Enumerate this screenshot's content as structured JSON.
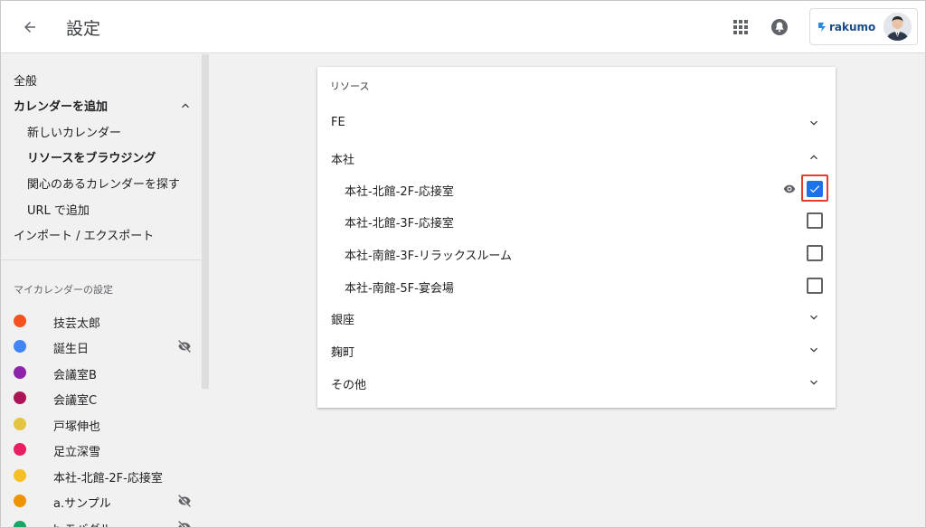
{
  "header": {
    "title": "設定",
    "brand": "rakumo",
    "icons": {
      "back": "arrow-back-icon",
      "apps": "apps-grid-icon",
      "notifications": "bell-icon"
    }
  },
  "sidebar": {
    "nav": [
      {
        "label": "全般"
      },
      {
        "label": "カレンダーを追加"
      },
      {
        "label": "新しいカレンダー"
      },
      {
        "label": "リソースをブラウジング"
      },
      {
        "label": "関心のあるカレンダーを探す"
      },
      {
        "label": "URL で追加"
      },
      {
        "label": "インポート / エクスポート"
      }
    ],
    "my_calendars_label": "マイカレンダーの設定",
    "calendars": [
      {
        "name": "技芸太郎",
        "color": "#f4511e",
        "hidden": false
      },
      {
        "name": "誕生日",
        "color": "#4285f4",
        "hidden": true
      },
      {
        "name": "会議室B",
        "color": "#8e24aa",
        "hidden": false
      },
      {
        "name": "会議室C",
        "color": "#ad1457",
        "hidden": false
      },
      {
        "name": "戸塚伸也",
        "color": "#e4c441",
        "hidden": false
      },
      {
        "name": "足立深雪",
        "color": "#e91e63",
        "hidden": false
      },
      {
        "name": "本社-北館-2F-応接室",
        "color": "#f6bf26",
        "hidden": false
      },
      {
        "name": "a.サンプル",
        "color": "#f09300",
        "hidden": true
      },
      {
        "name": "b.モバグル",
        "color": "#16a765",
        "hidden": true
      }
    ]
  },
  "resources": {
    "title": "リソース",
    "groups": [
      {
        "label": "FE",
        "expanded": false
      },
      {
        "label": "本社",
        "expanded": true
      },
      {
        "label": "銀座",
        "expanded": false
      },
      {
        "label": "麹町",
        "expanded": false
      },
      {
        "label": "その他",
        "expanded": false
      }
    ],
    "items": [
      {
        "label": "本社-北館-2F-応接室",
        "checked": true
      },
      {
        "label": "本社-北館-3F-応接室",
        "checked": false
      },
      {
        "label": "本社-南館-3F-リラックスルーム",
        "checked": false
      },
      {
        "label": "本社-南館-5F-宴会場",
        "checked": false
      }
    ]
  },
  "colors": {
    "accent": "#1a73e8",
    "highlight": "#e53935"
  }
}
